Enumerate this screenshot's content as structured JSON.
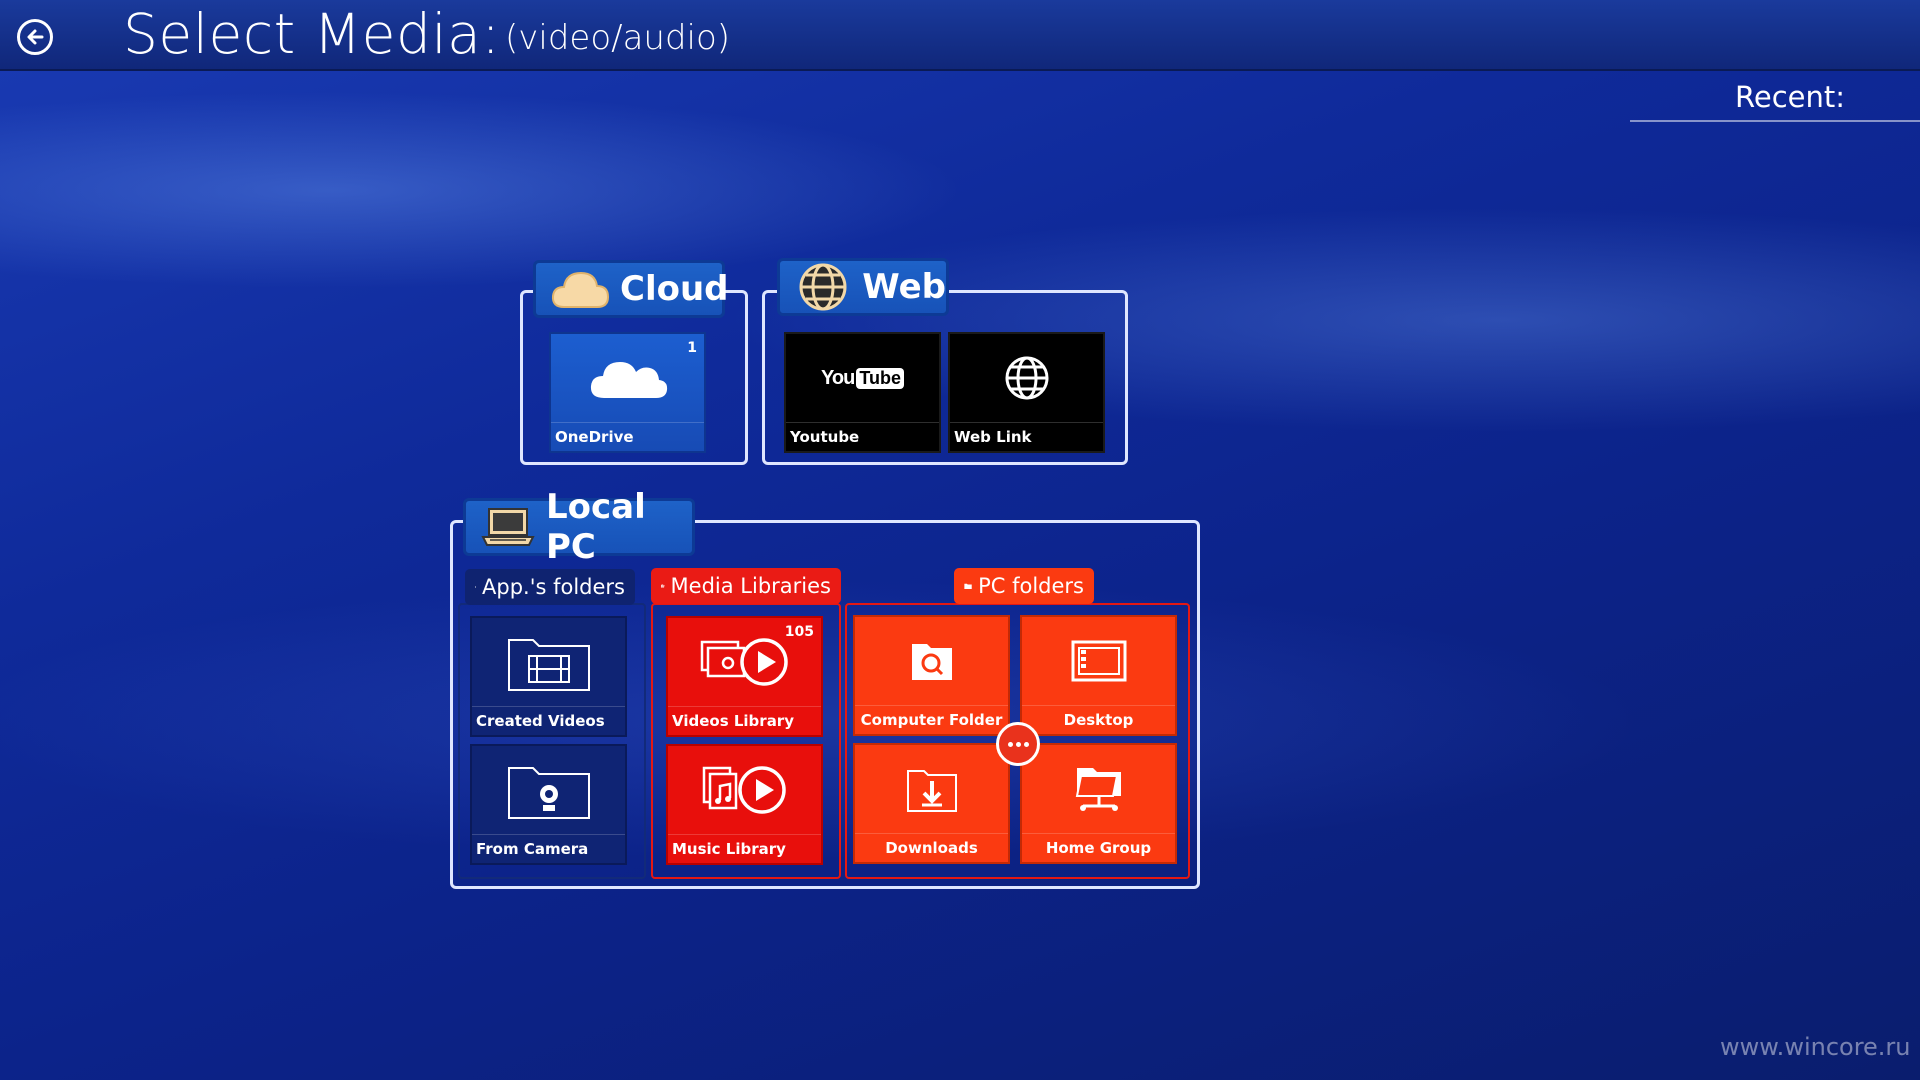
{
  "header": {
    "title": "Select Media:",
    "subtitle": "(video/audio)",
    "back_icon": "back-arrow-icon"
  },
  "recent": {
    "label": "Recent:"
  },
  "cloud": {
    "title": "Cloud",
    "icon": "cloud-icon",
    "tiles": [
      {
        "label": "OneDrive",
        "count": "1",
        "icon": "onedrive-icon"
      }
    ]
  },
  "web": {
    "title": "Web",
    "icon": "globe-icon",
    "tiles": [
      {
        "label": "Youtube",
        "icon": "youtube-icon",
        "logo_you": "You",
        "logo_tube": "Tube"
      },
      {
        "label": "Web Link",
        "icon": "globe-icon"
      }
    ]
  },
  "local": {
    "title": "Local PC",
    "icon": "laptop-icon",
    "apps_folders": {
      "title": "App.'s folders",
      "icon": "grid-icon",
      "tiles": [
        {
          "label": "Created Videos",
          "icon": "film-folder-icon"
        },
        {
          "label": "From Camera",
          "icon": "webcam-folder-icon"
        }
      ]
    },
    "media_libraries": {
      "title": "Media Libraries",
      "icon": "library-books-icon",
      "tiles": [
        {
          "label": "Videos Library",
          "count": "105",
          "icon": "video-library-icon"
        },
        {
          "label": "Music Library",
          "icon": "music-library-icon"
        }
      ]
    },
    "pc_folders": {
      "title": "PC folders",
      "icon": "folder-icon",
      "tiles": [
        {
          "label": "Computer Folder",
          "icon": "search-folder-icon"
        },
        {
          "label": "Desktop",
          "icon": "desktop-icon"
        },
        {
          "label": "Downloads",
          "icon": "download-folder-icon"
        },
        {
          "label": "Home Group",
          "icon": "network-folder-icon"
        }
      ],
      "more_icon": "more-dots-icon"
    }
  },
  "watermark": "www.wincore.ru",
  "colors": {
    "background": "#0f2a9a",
    "cloud_tile": "#1c5ed0",
    "web_tile": "#000000",
    "apps_tile": "#0f2474",
    "media_tile": "#e80f0c",
    "pc_tile": "#fb3a11"
  }
}
